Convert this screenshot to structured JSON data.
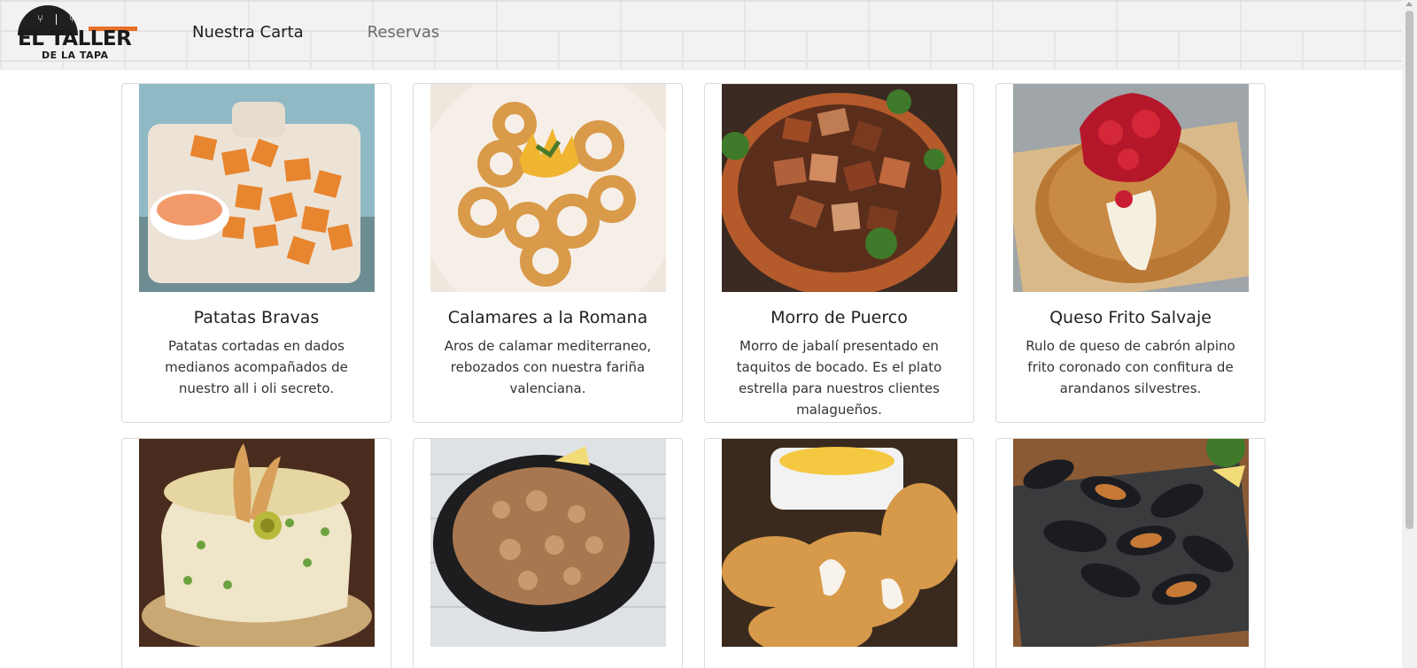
{
  "brand": {
    "line1": "EL TALLER",
    "line2": "DE LA TAPA",
    "accent_color": "#e8702a"
  },
  "nav": {
    "items": [
      {
        "label": "Nuestra Carta",
        "active": true
      },
      {
        "label": "Reservas",
        "active": false
      }
    ]
  },
  "menu": {
    "cards": [
      {
        "title": "Patatas Bravas",
        "description": "Patatas cortadas en dados medianos acompañados de nuestro all i oli secreto.",
        "image": "patatas-bravas-photo"
      },
      {
        "title": "Calamares a la Romana",
        "description": "Aros de calamar mediterraneo, rebozados con nuestra fariña valenciana.",
        "image": "calamares-photo"
      },
      {
        "title": "Morro de Puerco",
        "description": "Morro de jabalí presentado en taquitos de bocado. Es el plato estrella para nuestros clientes malagueños.",
        "image": "morro-photo"
      },
      {
        "title": "Queso Frito Salvaje",
        "description": "Rulo de queso de cabrón alpino frito coronado con confitura de arandanos silvestres.",
        "image": "queso-frito-photo"
      },
      {
        "title": "",
        "description": "",
        "image": "ensaladilla-photo"
      },
      {
        "title": "",
        "description": "",
        "image": "chopitos-photo"
      },
      {
        "title": "",
        "description": "",
        "image": "fried-fish-photo"
      },
      {
        "title": "",
        "description": "",
        "image": "mussels-photo"
      }
    ]
  }
}
